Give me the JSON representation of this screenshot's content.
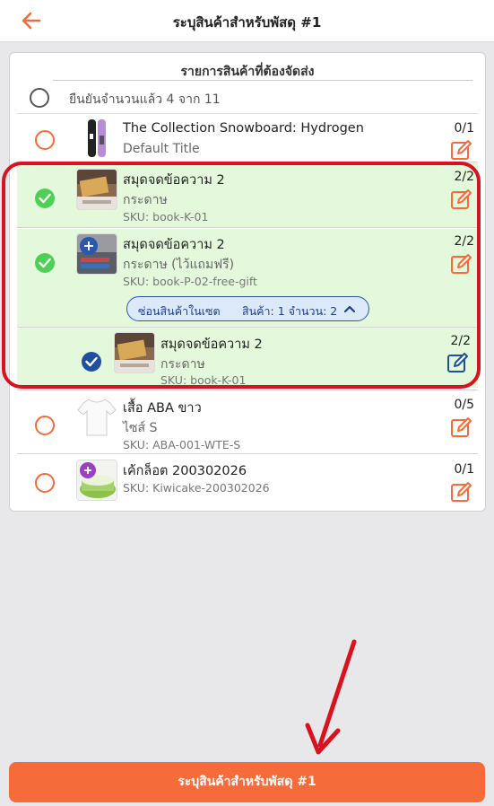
{
  "header": {
    "title": "ระบุสินค้าสำหรับพัสดุ #1",
    "back_icon": "arrow-left-icon",
    "accent": "#f56b3a"
  },
  "card": {
    "title": "รายการสินค้าที่ต้องจัดส่ง",
    "confirm_label": "ยืนยันจำนวนแล้ว 4 จาก 11"
  },
  "items": [
    {
      "name": "The Collection Snowboard: Hydrogen",
      "variant": "Default Title",
      "qty": "0/1",
      "status": "unchecked"
    },
    {
      "name": "สมุดจดข้อความ 2",
      "variant": "กระดาษ",
      "sku": "SKU: book-K-01",
      "qty": "2/2",
      "status": "checked"
    },
    {
      "name": "สมุดจดข้อความ 2",
      "variant": "กระดาษ (ไว้แถมฟรี)",
      "sku": "SKU: book-P-02-free-gift",
      "qty": "2/2",
      "status": "checked"
    },
    {
      "name": "สมุดจดข้อความ 2",
      "variant": "กระดาษ",
      "sku": "SKU: book-K-01",
      "qty": "2/2",
      "status": "checked-sub"
    },
    {
      "name": "เสื้อ ABA ขาว",
      "variant": "ไซส์ S",
      "sku": "SKU: ABA-001-WTE-S",
      "qty": "0/5",
      "status": "unchecked"
    },
    {
      "name": "เค้กล็อต 200302026",
      "sku": "SKU: Kiwicake-200302026",
      "qty": "0/1",
      "status": "unchecked"
    }
  ],
  "bundle": {
    "toggle_label": "ซ่อนสินค้าในเซต",
    "summary": "สินค้า: 1 จำนวน: 2"
  },
  "footer": {
    "button_label": "ระบุสินค้าสำหรับพัสดุ #1"
  },
  "colors": {
    "orange": "#f56b3a",
    "green": "#4fcf55",
    "blue": "#1f4f9e",
    "highlight": "#d8131f"
  }
}
